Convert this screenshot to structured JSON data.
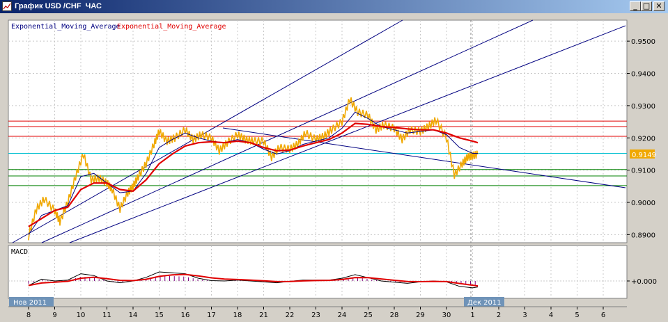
{
  "window": {
    "title": "График USD /CHF  ЧАС",
    "buttons": {
      "minimize": "_",
      "maximize": "□",
      "close": "✕"
    }
  },
  "colors": {
    "background": "#ffffff",
    "grid": "#c8c8c8",
    "price": "#f0a800",
    "ema_fast": "#000080",
    "ema_slow": "#e00000",
    "resistance": "#e00000",
    "support": "#008000",
    "cyan_level": "#00c0d0",
    "trendline": "#000080",
    "macd_hist": "#800080",
    "axis_pill": "#6f93b8"
  },
  "legend": [
    {
      "text": "Exponential_Moving_Average",
      "color": "#000080"
    },
    {
      "text": "Exponential_Moving_Average",
      "color": "#e00000"
    }
  ],
  "macd_label": "MACD",
  "month_labels": {
    "left": "Нов 2011",
    "right": "Дек 2011"
  },
  "chart_data": {
    "type": "line",
    "instrument": "USD /CHF",
    "timeframe": "ЧАС",
    "current_price": "0.9149",
    "x_ticks": [
      "8",
      "9",
      "10",
      "11",
      "14",
      "15",
      "16",
      "17",
      "18",
      "21",
      "22",
      "23",
      "24",
      "25",
      "28",
      "29",
      "30",
      "1",
      "2",
      "3",
      "4",
      "5",
      "6"
    ],
    "y_ticks": [
      "0.9500",
      "0.9400",
      "0.9300",
      "0.9200",
      "0.9100",
      "0.9000",
      "0.8900"
    ],
    "ylim": [
      0.8875,
      0.9565
    ],
    "macd_ticks": [
      "+0.000"
    ],
    "horizontal_levels": {
      "resistance": [
        0.9252,
        0.9235,
        0.9205
      ],
      "cyan": [
        0.9152
      ],
      "support": [
        0.9102,
        0.9082,
        0.9052
      ]
    },
    "series": [
      {
        "name": "price",
        "x": [
          0,
          0.3,
          0.6,
          1,
          1.2,
          1.5,
          1.8,
          2.1,
          2.4,
          2.7,
          3,
          3.2,
          3.5,
          3.8,
          4.0,
          4.2,
          4.5,
          4.8,
          5,
          5.3,
          5.6,
          6,
          6.3,
          6.6,
          7,
          7.3,
          7.6,
          8,
          8.3,
          8.6,
          9,
          9.3,
          9.6,
          10,
          10.3,
          10.6,
          11,
          11.3,
          11.6,
          12,
          12.3,
          12.6,
          13,
          13.3,
          13.6,
          14,
          14.3,
          14.6,
          15,
          15.3,
          15.6,
          16,
          16.3,
          16.6,
          16.8,
          17,
          17.2
        ],
        "y": [
          0.8895,
          0.898,
          0.901,
          0.8975,
          0.894,
          0.9,
          0.908,
          0.915,
          0.907,
          0.9075,
          0.906,
          0.904,
          0.898,
          0.903,
          0.905,
          0.908,
          0.912,
          0.918,
          0.922,
          0.919,
          0.92,
          0.9225,
          0.9195,
          0.921,
          0.92,
          0.916,
          0.9185,
          0.921,
          0.9195,
          0.919,
          0.919,
          0.914,
          0.917,
          0.9165,
          0.918,
          0.9215,
          0.9195,
          0.9205,
          0.9225,
          0.925,
          0.932,
          0.928,
          0.927,
          0.9225,
          0.924,
          0.923,
          0.9195,
          0.9225,
          0.922,
          0.9235,
          0.9255,
          0.92,
          0.9085,
          0.912,
          0.914,
          0.9145,
          0.9149
        ]
      },
      {
        "name": "ema_fast",
        "x": [
          0,
          0.5,
          1,
          1.5,
          2,
          2.5,
          3,
          3.5,
          4,
          4.5,
          5,
          5.5,
          6,
          6.5,
          7,
          7.5,
          8,
          8.5,
          9,
          9.5,
          10,
          10.5,
          11,
          11.5,
          12,
          12.5,
          13,
          13.5,
          14,
          14.5,
          15,
          15.5,
          16,
          16.5,
          17,
          17.2
        ],
        "y": [
          0.89,
          0.896,
          0.8975,
          0.899,
          0.908,
          0.909,
          0.906,
          0.903,
          0.9035,
          0.909,
          0.917,
          0.9195,
          0.9215,
          0.92,
          0.919,
          0.9185,
          0.9195,
          0.9185,
          0.9165,
          0.915,
          0.916,
          0.918,
          0.919,
          0.92,
          0.923,
          0.928,
          0.926,
          0.9235,
          0.9225,
          0.9215,
          0.922,
          0.9225,
          0.921,
          0.917,
          0.9152,
          0.9152
        ]
      },
      {
        "name": "ema_slow",
        "x": [
          0,
          0.5,
          1,
          1.5,
          2,
          2.5,
          3,
          3.5,
          4,
          4.5,
          5,
          5.5,
          6,
          6.5,
          7,
          7.5,
          8,
          8.5,
          9,
          9.5,
          10,
          10.5,
          11,
          11.5,
          12,
          12.5,
          13,
          13.5,
          14,
          14.5,
          15,
          15.5,
          16,
          16.5,
          17,
          17.2
        ],
        "y": [
          0.8925,
          0.895,
          0.8975,
          0.8985,
          0.904,
          0.906,
          0.906,
          0.904,
          0.9035,
          0.907,
          0.912,
          0.915,
          0.9175,
          0.9185,
          0.9188,
          0.9185,
          0.919,
          0.9185,
          0.917,
          0.916,
          0.9162,
          0.9175,
          0.9185,
          0.9195,
          0.9215,
          0.9245,
          0.9242,
          0.9235,
          0.9232,
          0.9228,
          0.9225,
          0.9225,
          0.9215,
          0.92,
          0.919,
          0.9185
        ]
      }
    ]
  }
}
